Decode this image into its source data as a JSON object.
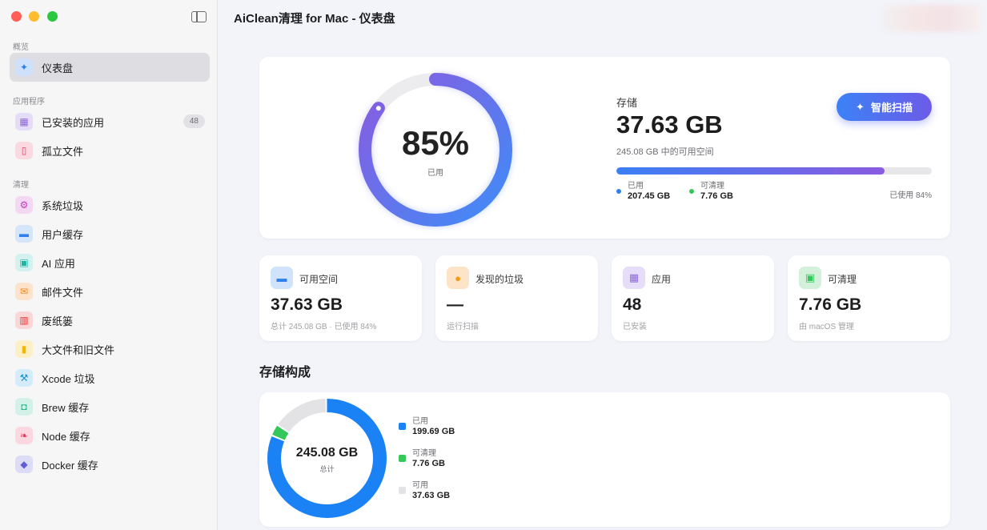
{
  "window": {
    "title": "AiClean清理 for Mac - 仪表盘"
  },
  "sidebar": {
    "sections": [
      "概览",
      "应用程序",
      "清理"
    ],
    "items": [
      {
        "label": "仪表盘",
        "icon": "sparkle-icon"
      },
      {
        "label": "已安装的应用",
        "icon": "grid-icon",
        "count": "48"
      },
      {
        "label": "孤立文件",
        "icon": "orphan-file-icon"
      },
      {
        "label": "系统垃圾",
        "icon": "gear-icon"
      },
      {
        "label": "用户缓存",
        "icon": "drive-icon"
      },
      {
        "label": "AI 应用",
        "icon": "chip-icon"
      },
      {
        "label": "邮件文件",
        "icon": "mail-icon"
      },
      {
        "label": "废纸篓",
        "icon": "trash-icon"
      },
      {
        "label": "大文件和旧文件",
        "icon": "document-icon"
      },
      {
        "label": "Xcode 垃圾",
        "icon": "hammer-icon"
      },
      {
        "label": "Brew 缓存",
        "icon": "mug-icon"
      },
      {
        "label": "Node 缓存",
        "icon": "leaf-icon"
      },
      {
        "label": "Docker 缓存",
        "icon": "cube-icon"
      }
    ]
  },
  "hero": {
    "percent": "85%",
    "percent_value": 85,
    "percent_label": "已用",
    "storage_label": "存储",
    "storage_value": "37.63 GB",
    "storage_sub": "245.08 GB 中的可用空间",
    "scan_button": "智能扫描",
    "bar_fill": 0.85,
    "legend": [
      {
        "label": "已用",
        "value": "207.45 GB",
        "color": "#2f80ed"
      },
      {
        "label": "可清理",
        "value": "7.76 GB",
        "color": "#34c759"
      }
    ],
    "used_text": "已使用 84%"
  },
  "stats": [
    {
      "title": "可用空间",
      "value": "37.63 GB",
      "note": "总计 245.08 GB · 已使用 84%",
      "icon": "drive-icon",
      "color": "#cfe3fb",
      "fg": "#2f80ed"
    },
    {
      "title": "发现的垃圾",
      "value": "—",
      "note": "运行扫描",
      "icon": "coin-icon",
      "color": "#fde3c8",
      "fg": "#f39c12"
    },
    {
      "title": "应用",
      "value": "48",
      "note": "已安装",
      "icon": "grid-icon",
      "color": "#e6def9",
      "fg": "#8e6bd8"
    },
    {
      "title": "可清理",
      "value": "7.76 GB",
      "note": "由 macOS 管理",
      "icon": "chip-icon",
      "color": "#d3f0da",
      "fg": "#34c759"
    }
  ],
  "composition": {
    "title": "存储构成",
    "total": "245.08 GB",
    "total_label": "总计",
    "legend": [
      {
        "label": "已用",
        "value": "199.69 GB",
        "color": "#1a82f5"
      },
      {
        "label": "可清理",
        "value": "7.76 GB",
        "color": "#34c759"
      },
      {
        "label": "可用",
        "value": "37.63 GB",
        "color": "#e3e3e6"
      }
    ],
    "segments": [
      199.69,
      7.76,
      37.63
    ]
  },
  "colors": {
    "accent": "#2f80ed",
    "purple": "#8a5be0"
  }
}
